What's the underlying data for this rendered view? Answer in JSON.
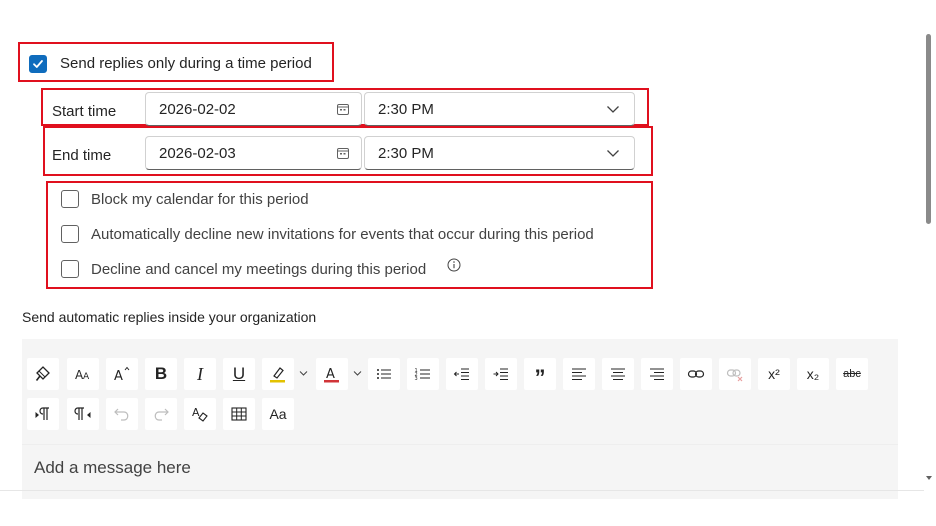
{
  "period_option": {
    "label": "Send replies only during a time period",
    "checked": true
  },
  "start": {
    "label": "Start time",
    "date": "2026-02-02",
    "time": "2:30 PM"
  },
  "end": {
    "label": "End time",
    "date": "2026-02-03",
    "time": "2:30 PM"
  },
  "options": [
    {
      "label": "Block my calendar for this period",
      "checked": false
    },
    {
      "label": "Automatically decline new invitations for events that occur during this period",
      "checked": false
    },
    {
      "label": "Decline and cancel my meetings during this period",
      "checked": false
    }
  ],
  "inside_org_heading": "Send automatic replies inside your organization",
  "toolbar": {
    "buttons": [
      "format-painter-icon",
      "font-size-icon",
      "grow-font-icon",
      "bold-icon",
      "italic-icon",
      "underline-icon",
      "highlight-icon",
      "font-color-icon",
      "bullets-icon",
      "numbering-icon",
      "decrease-indent-icon",
      "increase-indent-icon",
      "quote-icon",
      "align-left-icon",
      "align-center-icon",
      "align-right-icon",
      "link-icon",
      "remove-link-icon",
      "superscript-icon",
      "subscript-icon",
      "strikethrough-icon",
      "ltr-icon",
      "rtl-icon",
      "undo-icon",
      "redo-icon",
      "clear-format-icon",
      "table-icon",
      "change-case-icon"
    ],
    "bold": "B",
    "italic": "I",
    "underline": "U",
    "superscript": "x²",
    "subscript": "x₂",
    "strike": "abc",
    "quote": "”",
    "change_case": "Aa",
    "highlight_color": "#e3c200",
    "font_color": "#d13438"
  },
  "message": {
    "placeholder": "Add a message here"
  },
  "colors": {
    "accent": "#0f6cbd",
    "highlight_box": "#e0101e"
  }
}
